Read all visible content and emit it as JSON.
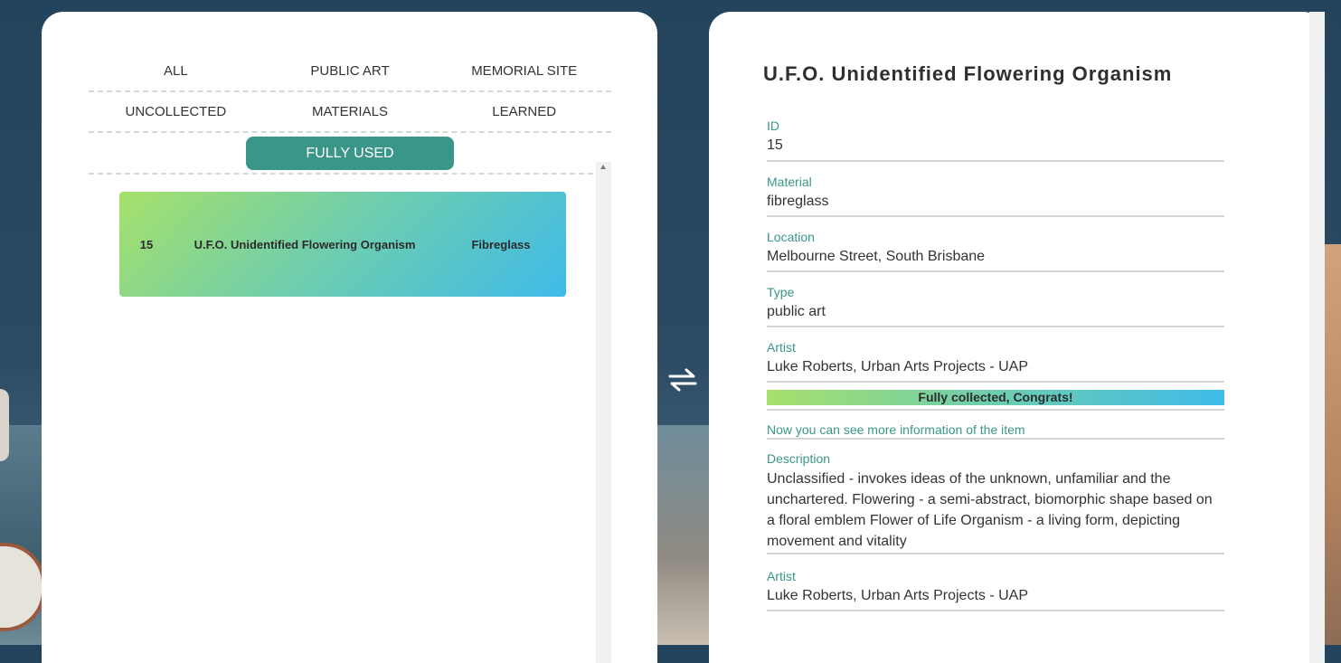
{
  "filters": {
    "row1": [
      "ALL",
      "PUBLIC ART",
      "MEMORIAL SITE"
    ],
    "row2": [
      "UNCOLLECTED",
      "MATERIALS",
      "LEARNED"
    ],
    "active": "FULLY USED"
  },
  "list": [
    {
      "id": "15",
      "name": "U.F.O. Unidentified Flowering Organism",
      "material": "Fibreglass"
    }
  ],
  "detail": {
    "title": "U.F.O. Unidentified Flowering Organism",
    "id_label": "ID",
    "id_value": "15",
    "material_label": "Material",
    "material_value": "fibreglass",
    "location_label": "Location",
    "location_value": "Melbourne Street, South Brisbane",
    "type_label": "Type",
    "type_value": "public art",
    "artist_label": "Artist",
    "artist_value": "Luke Roberts, Urban Arts Projects - UAP",
    "congrats": "Fully collected, Congrats!",
    "more_info": "Now you can see more information of the item",
    "description_label": "Description",
    "description_value": "Unclassified - invokes ideas of the unknown, unfamiliar and the unchartered. Flowering - a semi-abstract, biomorphic shape based on a floral emblem Flower of Life Organism - a living form, depicting movement and vitality",
    "artist2_label": "Artist",
    "artist2_value": "Luke Roberts, Urban Arts Projects - UAP"
  },
  "colors": {
    "accent": "#3a9688",
    "gradient_start": "#a6e06a",
    "gradient_end": "#3fbbe9"
  },
  "icons": {
    "swap": "swap-arrows-icon"
  }
}
